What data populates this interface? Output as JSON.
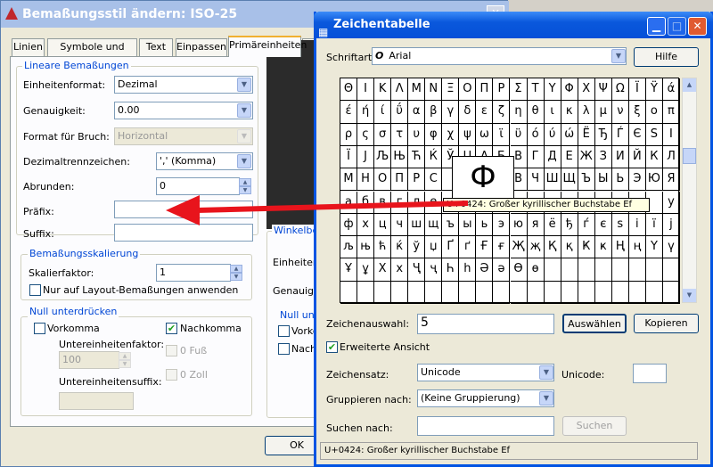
{
  "left_dialog": {
    "title": "Bemaßungsstil ändern: ISO-25",
    "close_glyph": "X",
    "tabs": [
      "Linien",
      "Symbole und Pfeile",
      "Text",
      "Einpassen",
      "Primäreinheiten",
      "Al"
    ],
    "active_tab": "Primäreinheiten",
    "linear_group": "Lineare Bemaßungen",
    "unit_format_label": "Einheitenformat:",
    "unit_format_value": "Dezimal",
    "precision_label": "Genauigkeit:",
    "precision_value": "0.00",
    "fraction_label": "Format für Bruch:",
    "fraction_value": "Horizontal",
    "decimal_sep_label": "Dezimaltrennzeichen:",
    "decimal_sep_value": "',' (Komma)",
    "round_label": "Abrunden:",
    "round_value": "0",
    "prefix_label": "Präfix:",
    "prefix_value": "",
    "suffix_label": "Suffix:",
    "suffix_value": "",
    "scale_group": "Bemaßungsskalierung",
    "scale_label": "Skalierfaktor:",
    "scale_value": "1",
    "layout_only_label": "Nur auf Layout-Bemaßungen anwenden",
    "zero_group": "Null unterdrücken",
    "leading_label": "Vorkomma",
    "trailing_label": "Nachkomma",
    "subunit_factor_label": "Untereinheitenfaktor:",
    "subunit_factor_value": "100",
    "feet_label": "0 Fuß",
    "inch_label": "0 Zoll",
    "subunit_suffix_label": "Untereinheitensuffix:",
    "subunit_suffix_value": "",
    "angle_group": "Winkelbe",
    "angle_units_label": "Einheitenf",
    "angle_precision_label": "Genauigk",
    "angle_zero_group": "Null unte",
    "angle_leading_label": "Vorko",
    "angle_trailing_label": "Nach",
    "ok_label": "OK"
  },
  "charmap": {
    "title": "Zeichentabelle",
    "font_label": "Schriftart:",
    "font_icon": "O",
    "font_value": "Arial",
    "help_label": "Hilfe",
    "chars": [
      "Θ",
      "Ι",
      "Κ",
      "Λ",
      "Μ",
      "Ν",
      "Ξ",
      "Ο",
      "Π",
      "Ρ",
      "Σ",
      "Τ",
      "Υ",
      "Φ",
      "Χ",
      "Ψ",
      "Ω",
      "Ϊ",
      "Ϋ",
      "ά",
      "έ",
      "ή",
      "ί",
      "ΰ",
      "α",
      "β",
      "γ",
      "δ",
      "ε",
      "ζ",
      "η",
      "θ",
      "ι",
      "κ",
      "λ",
      "μ",
      "ν",
      "ξ",
      "ο",
      "π",
      "ρ",
      "ς",
      "σ",
      "τ",
      "υ",
      "φ",
      "χ",
      "ψ",
      "ω",
      "ϊ",
      "ϋ",
      "ό",
      "ύ",
      "ώ",
      "Ё",
      "Ђ",
      "Ѓ",
      "Є",
      "Ѕ",
      "І",
      "Ї",
      "Ј",
      "Љ",
      "Њ",
      "Ћ",
      "Ќ",
      "Ў",
      "Џ",
      "А",
      "Б",
      "В",
      "Г",
      "Д",
      "Е",
      "Ж",
      "З",
      "И",
      "Й",
      "К",
      "Л",
      "М",
      "Н",
      "О",
      "П",
      "Р",
      "С",
      "",
      "",
      "",
      "",
      "В",
      "Ч",
      "Ш",
      "Щ",
      "Ъ",
      "Ы",
      "Ь",
      "Э",
      "Ю",
      "Я",
      "а",
      "б",
      "в",
      "г",
      "д",
      "е",
      "",
      "",
      "",
      "",
      "",
      "",
      "",
      "",
      "",
      "",
      "",
      "",
      "",
      "у",
      "ф",
      "х",
      "ц",
      "ч",
      "ш",
      "щ",
      "ъ",
      "ы",
      "ь",
      "э",
      "ю",
      "я",
      "ё",
      "ђ",
      "ѓ",
      "є",
      "ѕ",
      "і",
      "ї",
      "ј",
      "љ",
      "њ",
      "ћ",
      "ќ",
      "ў",
      "џ",
      "Ґ",
      "ґ",
      "Ғ",
      "ғ",
      "Җ",
      "җ",
      "Қ",
      "қ",
      "Ҝ",
      "ҝ",
      "Ң",
      "ң",
      "Ү",
      "ү",
      "Ұ",
      "ұ",
      "Х",
      "х",
      "Ҷ",
      "ҷ",
      "Һ",
      "һ",
      "Ә",
      "ә",
      "Ө",
      "ө",
      "",
      "",
      "",
      "",
      "",
      "",
      "",
      "",
      "",
      "",
      "",
      "",
      "",
      "",
      "",
      "",
      "",
      "",
      "",
      "",
      "",
      "",
      "",
      "",
      "",
      "",
      "",
      ""
    ],
    "zoom_char": "Ф",
    "tooltip": "U+0424: Großer kyrillischer Buchstabe Ef",
    "selection_label": "Zeichenauswahl:",
    "selection_value": "5",
    "select_button": "Auswählen",
    "copy_button": "Kopieren",
    "advanced_label": "Erweiterte Ansicht",
    "charset_label": "Zeichensatz:",
    "charset_value": "Unicode",
    "unicode_label": "Unicode:",
    "unicode_value": "",
    "group_label": "Gruppieren nach:",
    "group_value": "(Keine Gruppierung)",
    "search_label": "Suchen nach:",
    "search_value": "",
    "search_button": "Suchen",
    "status": "U+0424: Großer kyrillischer Buchstabe Ef"
  },
  "colors": {
    "title_blue": "#0a58dc",
    "arrow_red": "#e8141c",
    "group_label": "#0046d5"
  }
}
